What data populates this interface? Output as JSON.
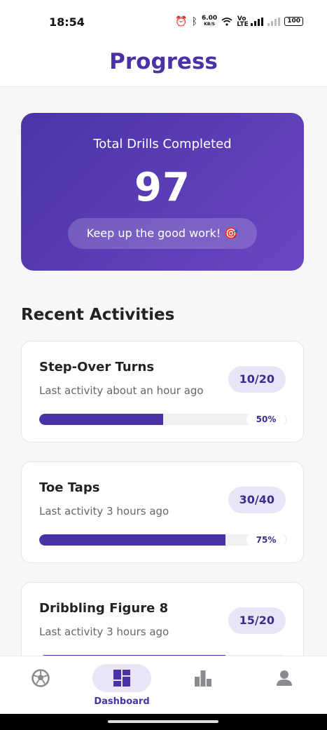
{
  "status_bar": {
    "time": "18:54",
    "speed_value": "6.00",
    "speed_unit": "KB/S",
    "network": "Vo LTE",
    "battery": "100"
  },
  "header": {
    "title": "Progress"
  },
  "summary": {
    "label": "Total Drills Completed",
    "total": "97",
    "message": "Keep up the good work! 🎯"
  },
  "recent": {
    "title": "Recent Activities",
    "items": [
      {
        "name": "Step-Over Turns",
        "subtitle": "Last activity about an hour ago",
        "count": "10/20",
        "percent_label": "50%",
        "progress": 0.5
      },
      {
        "name": "Toe Taps",
        "subtitle": "Last activity 3 hours ago",
        "count": "30/40",
        "percent_label": "75%",
        "progress": 0.75
      },
      {
        "name": "Dribbling Figure 8",
        "subtitle": "Last activity 3 hours ago",
        "count": "15/20",
        "percent_label": "",
        "progress": 0.75
      }
    ]
  },
  "bottom_nav": {
    "items": [
      {
        "icon": "soccer-ball-icon",
        "label": ""
      },
      {
        "icon": "dashboard-icon",
        "label": "Dashboard",
        "active": true
      },
      {
        "icon": "bar-chart-icon",
        "label": ""
      },
      {
        "icon": "person-icon",
        "label": ""
      }
    ]
  },
  "colors": {
    "accent": "#4a32a6",
    "hero_gradient_start": "#4a33a8",
    "hero_gradient_end": "#6a47c2",
    "badge_bg": "#e9e5f6",
    "inactive_icon": "#8a8a8f"
  }
}
